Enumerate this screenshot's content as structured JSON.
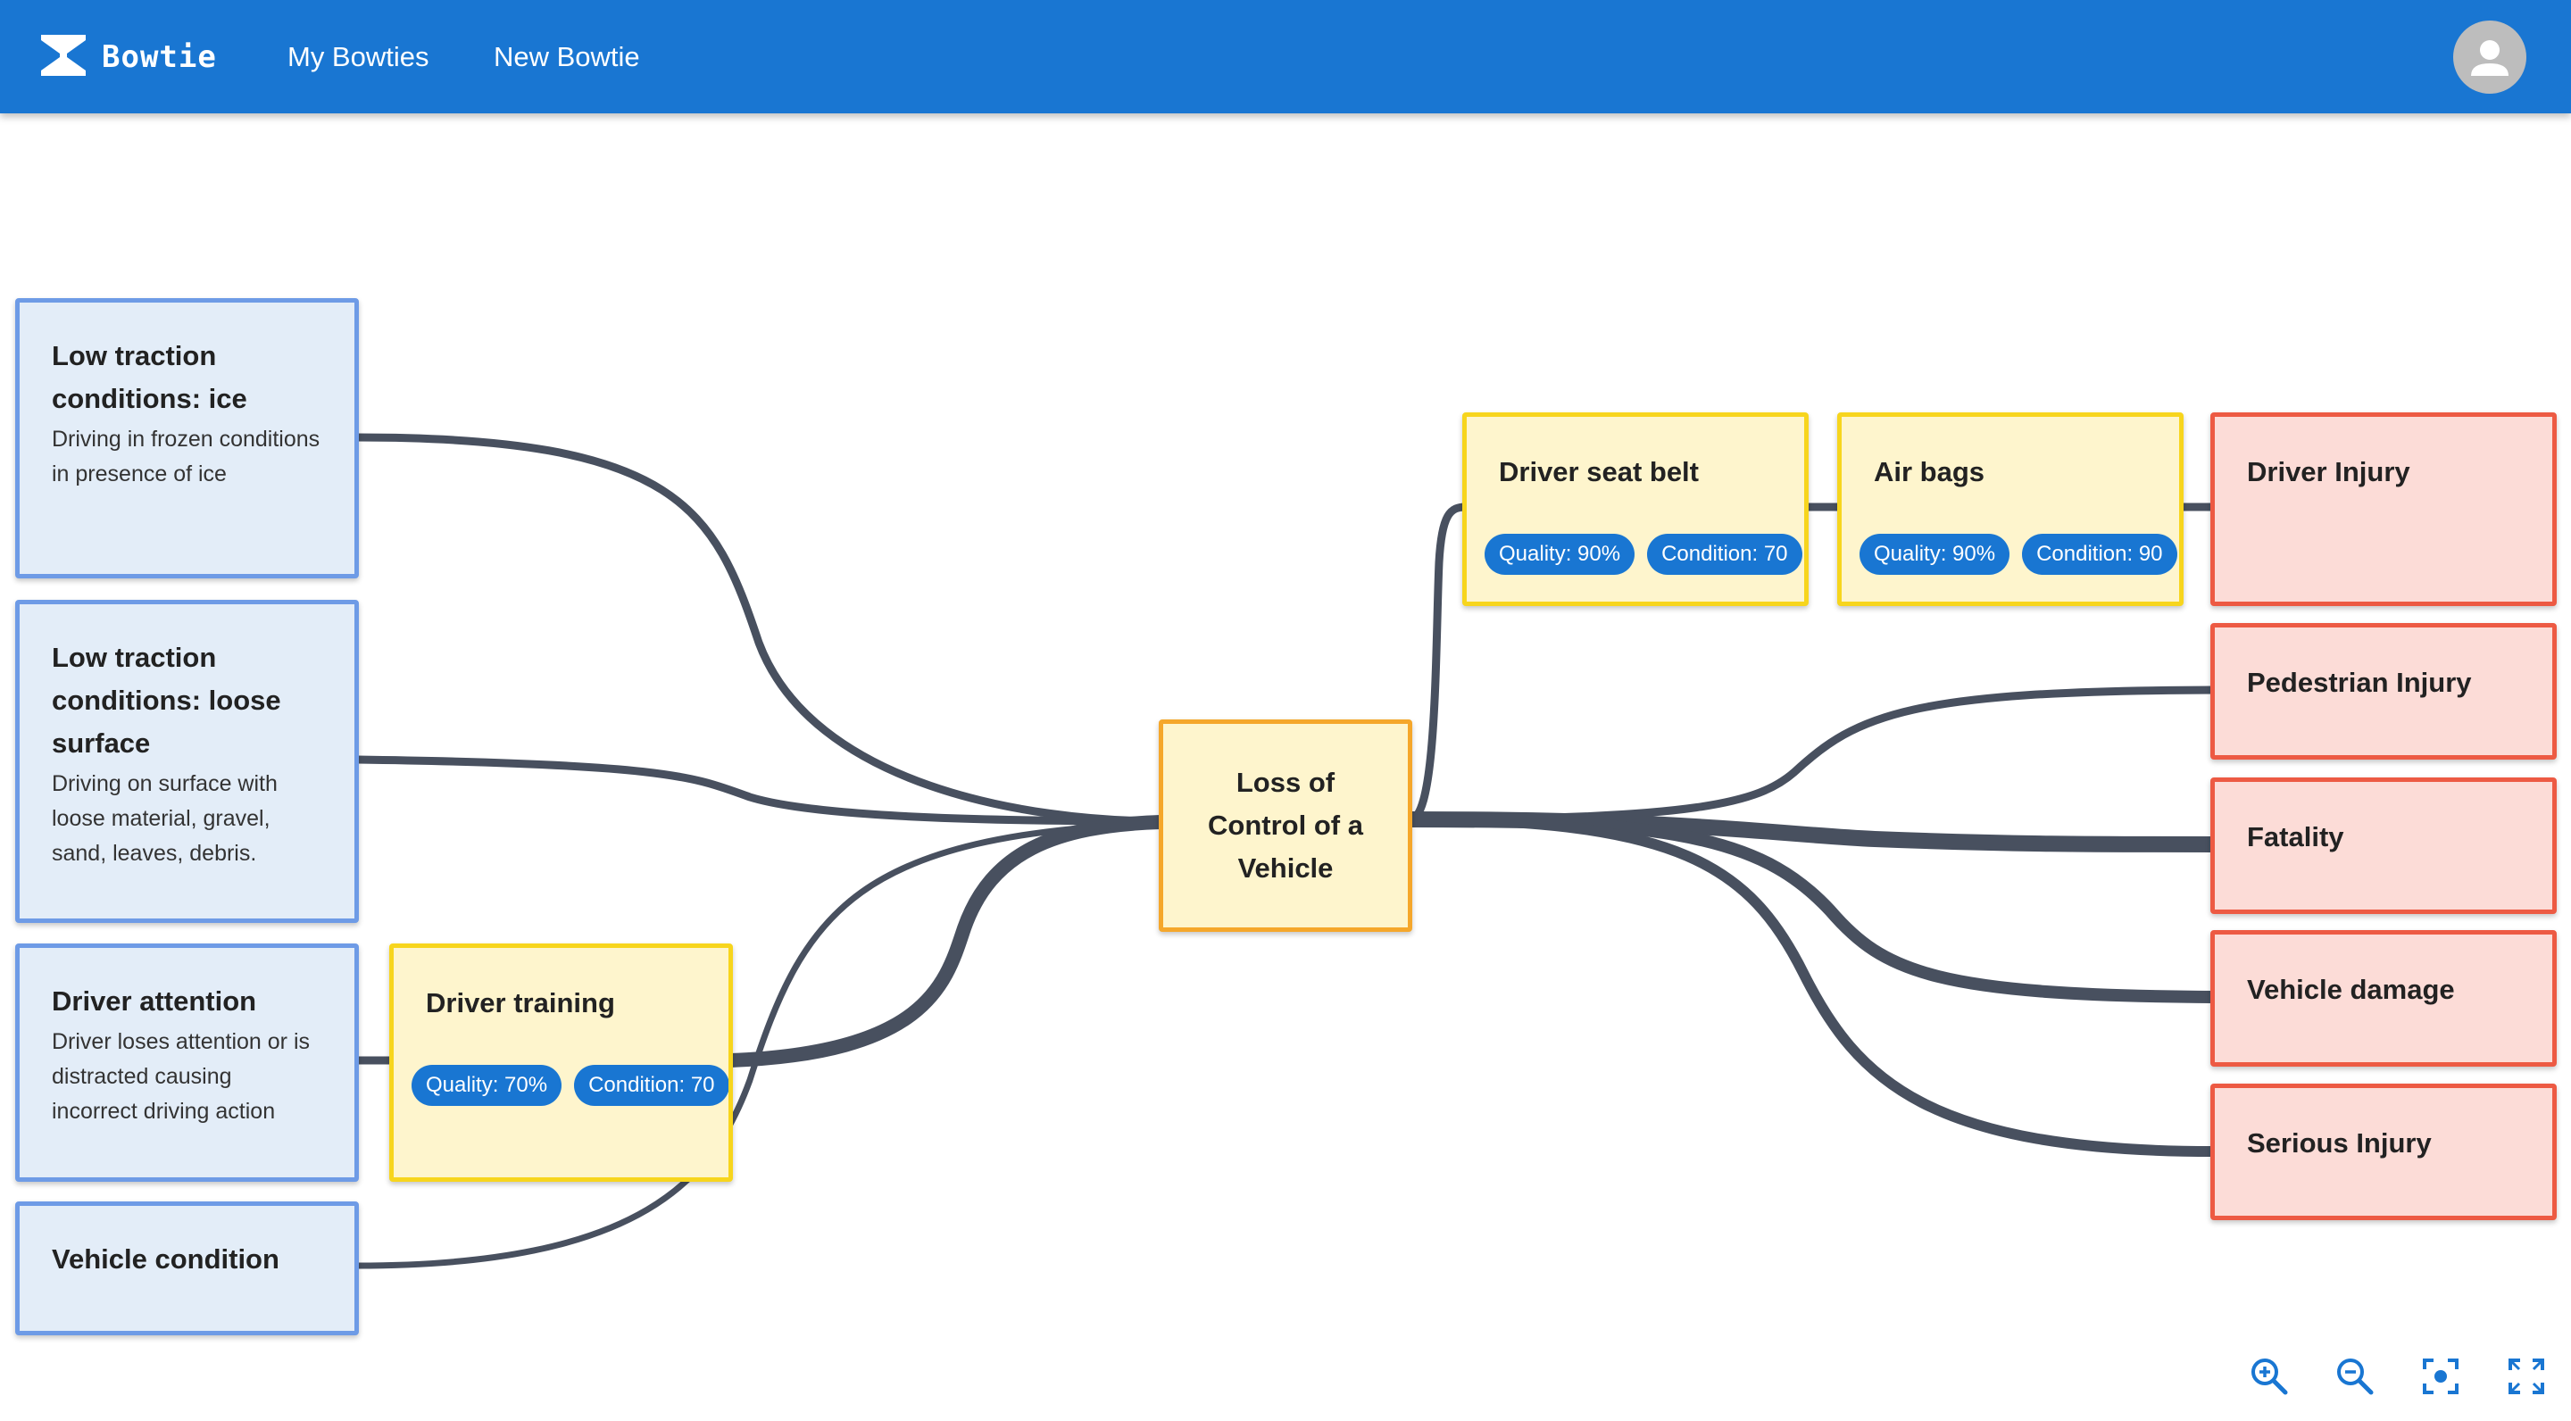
{
  "app": {
    "brand": "Bowtie",
    "nav": [
      "My Bowties",
      "New Bowtie"
    ],
    "avatar_icon": "account-circle-icon",
    "accent_color": "#1976d2"
  },
  "diagram": {
    "threats": [
      {
        "title": "Low traction conditions: ice",
        "description": "Driving in frozen conditions in presence of ice"
      },
      {
        "title": "Low traction conditions: loose surface",
        "description": "Driving on surface with loose material, gravel, sand, leaves, debris."
      },
      {
        "title": "Driver attention",
        "description": "Driver loses attention or is distracted causing incorrect driving action"
      },
      {
        "title": "Vehicle condition",
        "description": ""
      }
    ],
    "preventive_barriers": [
      {
        "title": "Driver training",
        "chips": [
          "Quality: 70%",
          "Condition: 70"
        ]
      }
    ],
    "top_event": {
      "title": "Loss of Control of a Vehicle"
    },
    "mitigating_barriers": [
      {
        "title": "Driver seat belt",
        "chips": [
          "Quality: 90%",
          "Condition: 70"
        ]
      },
      {
        "title": "Air bags",
        "chips": [
          "Quality: 90%",
          "Condition: 90"
        ]
      }
    ],
    "consequences": [
      {
        "title": "Driver Injury"
      },
      {
        "title": "Pedestrian Injury"
      },
      {
        "title": "Fatality"
      },
      {
        "title": "Vehicle damage"
      },
      {
        "title": "Serious Injury"
      }
    ],
    "colors": {
      "threat_fill": "#e3edf8",
      "threat_border": "#6e9be6",
      "barrier_fill": "#fef5cd",
      "barrier_border": "#f7d51d",
      "event_border": "#f5a72b",
      "consequence_fill": "#fcdcd7",
      "consequence_border": "#ed5a43",
      "link": "#48505f"
    }
  },
  "controls": {
    "icons": [
      "zoom-in-icon",
      "zoom-out-icon",
      "center-focus-icon",
      "fullscreen-icon"
    ]
  }
}
